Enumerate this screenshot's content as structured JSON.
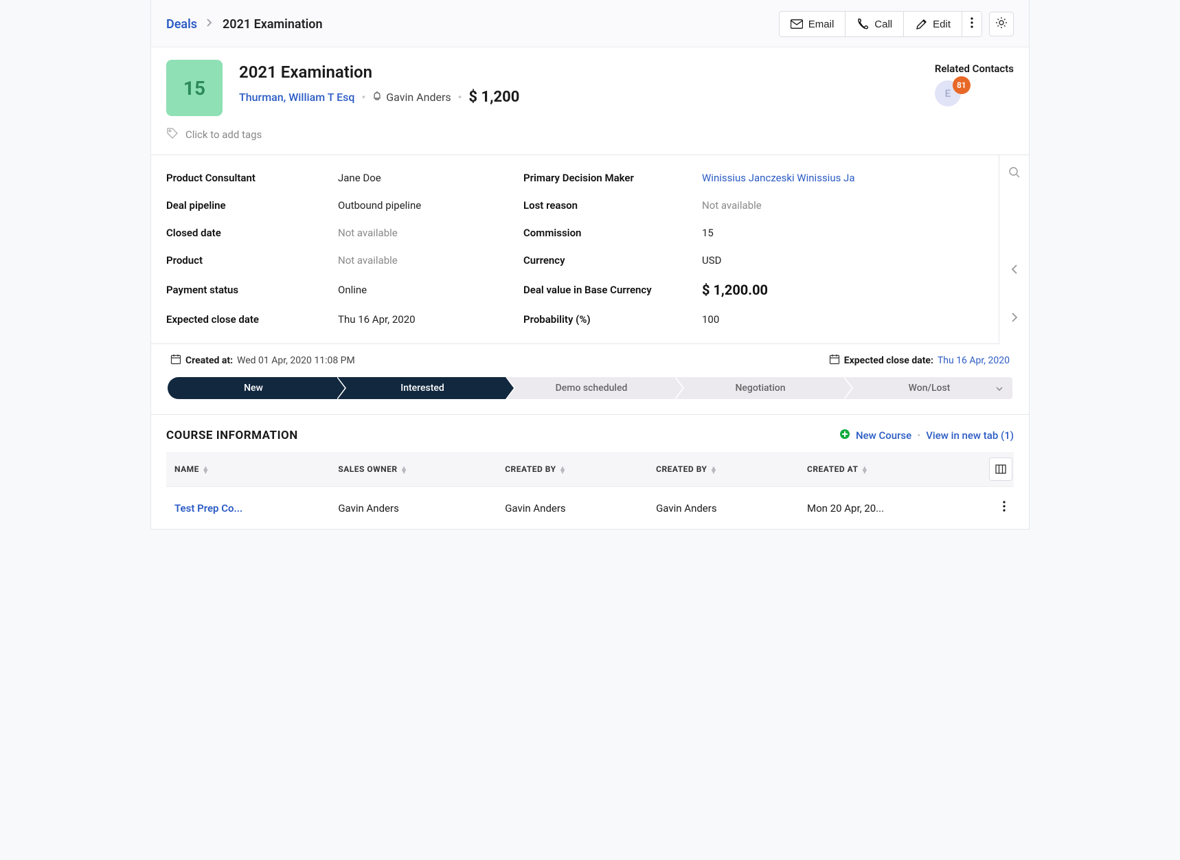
{
  "breadcrumb": {
    "root": "Deals",
    "current": "2021 Examination"
  },
  "actions": {
    "email": "Email",
    "call": "Call",
    "edit": "Edit"
  },
  "summary": {
    "score": "15",
    "title": "2021 Examination",
    "company": "Thurman, William T Esq",
    "owner": "Gavin Anders",
    "value": "$ 1,200",
    "related_label": "Related Contacts",
    "related_initial": "E",
    "related_count": "81"
  },
  "tags_placeholder": "Click to add tags",
  "details": {
    "left": [
      {
        "label": "Product Consultant",
        "value": "Jane Doe"
      },
      {
        "label": "Deal pipeline",
        "value": "Outbound pipeline"
      },
      {
        "label": "Closed date",
        "value": "Not available",
        "muted": true
      },
      {
        "label": "Product",
        "value": "Not available",
        "muted": true
      },
      {
        "label": "Payment status",
        "value": "Online"
      },
      {
        "label": "Expected close date",
        "value": "Thu 16 Apr, 2020"
      }
    ],
    "right": [
      {
        "label": "Primary Decision Maker",
        "value": "Winissius Janczeski Winissius Ja",
        "link": true
      },
      {
        "label": "Lost reason",
        "value": "Not available",
        "muted": true
      },
      {
        "label": "Commission",
        "value": "15"
      },
      {
        "label": "Currency",
        "value": "USD"
      },
      {
        "label": "Deal value in Base Currency",
        "value": "$ 1,200.00",
        "big": true
      },
      {
        "label": "Probability (%)",
        "value": "100"
      }
    ]
  },
  "meta": {
    "created_label": "Created at:",
    "created_value": "Wed 01 Apr, 2020 11:08 PM",
    "expected_label": "Expected close date:",
    "expected_value": "Thu 16 Apr, 2020"
  },
  "stages": [
    "New",
    "Interested",
    "Demo scheduled",
    "Negotiation",
    "Won/Lost"
  ],
  "stages_active_until": 1,
  "course": {
    "section_title": "COURSE INFORMATION",
    "new_label": "New Course",
    "view_label": "View in new tab (1)",
    "columns": [
      "NAME",
      "SALES OWNER",
      "CREATED BY",
      "CREATED BY",
      "CREATED AT"
    ],
    "rows": [
      {
        "name": "Test Prep Co...",
        "sales_owner": "Gavin Anders",
        "created_by1": "Gavin Anders",
        "created_by2": "Gavin Anders",
        "created_at": "Mon 20 Apr, 20..."
      }
    ]
  }
}
